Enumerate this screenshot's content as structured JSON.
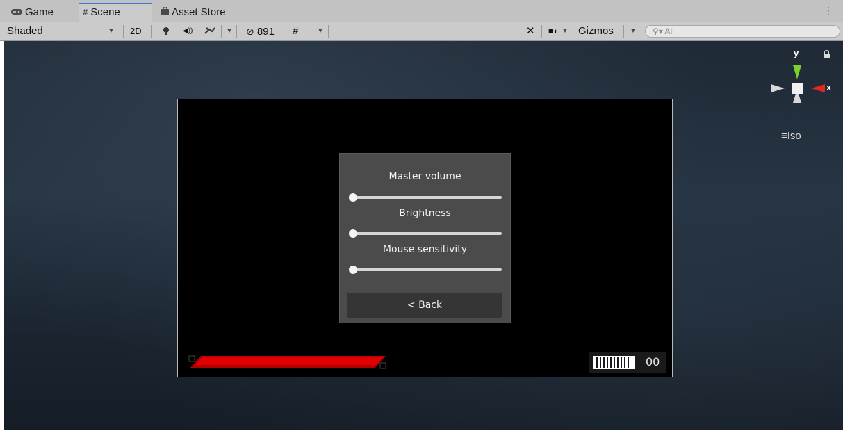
{
  "tabs": [
    {
      "label": "Game",
      "icon": "gamepad-icon"
    },
    {
      "label": "Scene",
      "icon": "grid-icon"
    },
    {
      "label": "Asset Store",
      "icon": "bag-icon"
    }
  ],
  "toolbar": {
    "shading_mode": "Shaded",
    "mode_2d": "2D",
    "hidden_count": "891",
    "gizmos_label": "Gizmos",
    "search_placeholder": "All"
  },
  "scene": {
    "axis_y": "y",
    "axis_x": "x",
    "projection": "Iso"
  },
  "game_ui": {
    "settings": {
      "master_volume_label": "Master volume",
      "master_volume_value": 0,
      "brightness_label": "Brightness",
      "brightness_value": 0,
      "mouse_sensitivity_label": "Mouse sensitivity",
      "mouse_sensitivity_value": 0,
      "back_label": "< Back"
    },
    "ammo_count": "00",
    "health_color": "#e00000"
  }
}
